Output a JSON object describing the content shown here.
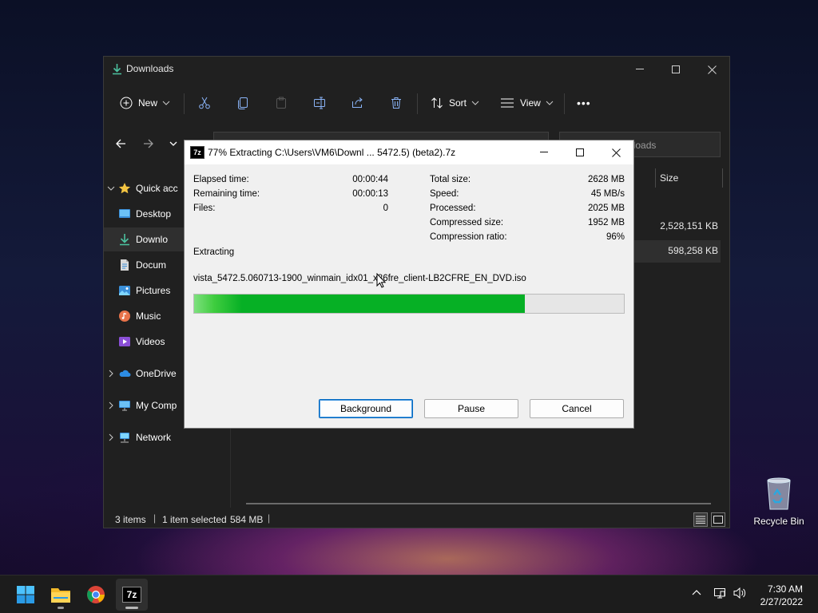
{
  "explorer": {
    "title": "Downloads",
    "toolbar": {
      "new_label": "New",
      "sort_label": "Sort",
      "view_label": "View",
      "more_label": "•••"
    },
    "search_placeholder": "nloads",
    "sidebar": [
      {
        "label": "Quick acc",
        "icon": "star-icon"
      },
      {
        "label": "Desktop",
        "icon": "desktop-icon"
      },
      {
        "label": "Downlo",
        "icon": "download-icon"
      },
      {
        "label": "Docum",
        "icon": "documents-icon"
      },
      {
        "label": "Pictures",
        "icon": "pictures-icon"
      },
      {
        "label": "Music",
        "icon": "music-icon"
      },
      {
        "label": "Videos",
        "icon": "videos-icon"
      },
      {
        "label": "OneDrive",
        "icon": "onedrive-icon"
      },
      {
        "label": "My Comp",
        "icon": "computer-icon"
      },
      {
        "label": "Network",
        "icon": "network-icon"
      }
    ],
    "columns": {
      "size": "Size"
    },
    "rows": [
      {
        "size": "2,528,151 KB"
      },
      {
        "size": "598,258 KB"
      }
    ],
    "status": {
      "items": "3 items",
      "selected": "1 item selected",
      "selected_size": "584 MB"
    }
  },
  "dialog": {
    "title": "77% Extracting C:\\Users\\VM6\\Downl ... 5472.5) (beta2).7z",
    "icon_text": "7z",
    "left_stats": [
      {
        "label": "Elapsed time:",
        "value": "00:00:44"
      },
      {
        "label": "Remaining time:",
        "value": "00:00:13"
      },
      {
        "label": "Files:",
        "value": "0"
      }
    ],
    "right_stats": [
      {
        "label": "Total size:",
        "value": "2628 MB"
      },
      {
        "label": "Speed:",
        "value": "45 MB/s"
      },
      {
        "label": "Processed:",
        "value": "2025 MB"
      },
      {
        "label": "Compressed size:",
        "value": "1952 MB"
      },
      {
        "label": "Compression ratio:",
        "value": "96%"
      }
    ],
    "status_label": "Extracting",
    "current_file": "vista_5472.5.060713-1900_winmain_idx01_x86fre_client-LB2CFRE_EN_DVD.iso",
    "progress_fraction": 0.77,
    "buttons": {
      "background": "Background",
      "pause": "Pause",
      "cancel": "Cancel"
    }
  },
  "desktop": {
    "recycle_bin_label": "Recycle Bin"
  },
  "taskbar": {
    "apps": [
      {
        "name": "start",
        "icon": "windows-logo-icon"
      },
      {
        "name": "file-explorer",
        "icon": "folder-icon"
      },
      {
        "name": "chrome",
        "icon": "chrome-icon"
      },
      {
        "name": "7-zip",
        "icon": "7zip-icon",
        "label": "7z"
      }
    ],
    "time": "7:30 AM",
    "date": "2/27/2022"
  },
  "colors": {
    "progress": "#06b025",
    "accent": "#0067c0",
    "explorer_bg": "#202020",
    "taskbar_bg": "#1c1c1c"
  }
}
